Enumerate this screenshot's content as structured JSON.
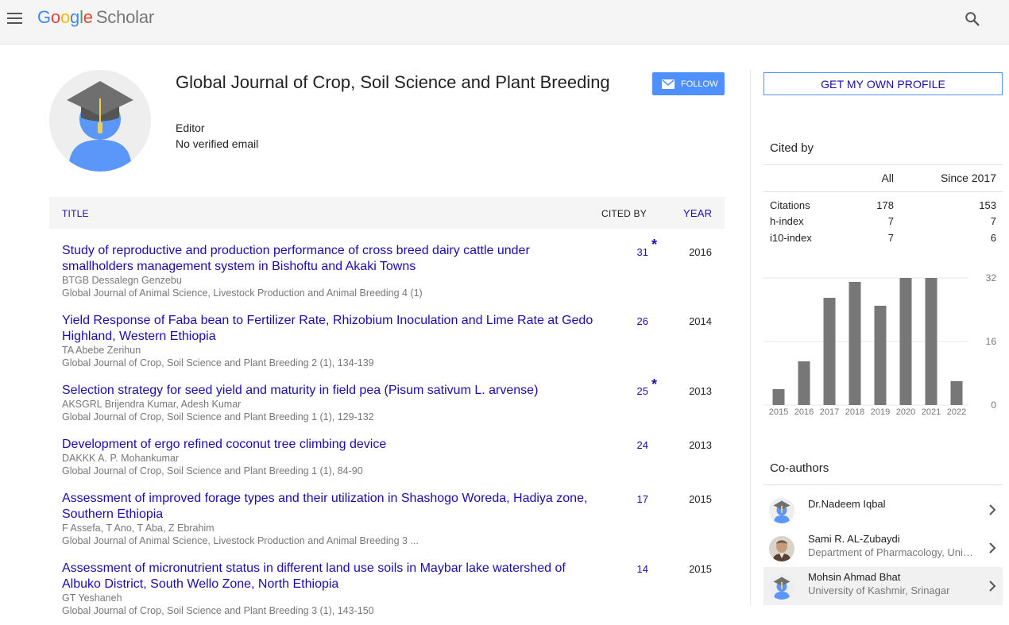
{
  "header": {
    "logo_g": "G",
    "logo_o1": "o",
    "logo_o2": "o",
    "logo_g2": "g",
    "logo_l": "l",
    "logo_e": "e",
    "logo_scholar": "Scholar",
    "menu_icon": "hamburger-icon",
    "search_icon": "search-icon"
  },
  "profile": {
    "name": "Global Journal of Crop, Soil Science and Plant Breeding",
    "affiliation": "Editor",
    "email": "No verified email",
    "follow_label": "FOLLOW"
  },
  "table": {
    "col_title": "TITLE",
    "col_cited": "CITED BY",
    "col_year": "YEAR",
    "rows": [
      {
        "title": "Study of reproductive and production performance of cross breed dairy cattle under smallholders management system in Bishoftu and Akaki Towns",
        "authors": "BTGB Dessalegn Genzebu",
        "venue": "Global Journal of Animal Science, Livestock Production and Animal Breeding 4 (1)",
        "cites": "31",
        "star": "*",
        "year": "2016"
      },
      {
        "title": "Yield Response of Faba bean to Fertilizer Rate, Rhizobium Inoculation and Lime Rate at Gedo Highland, Western Ethiopia",
        "authors": "TA Abebe Zerihun",
        "venue": "Global Journal of Crop, Soil Science and Plant Breeding 2 (1), 134-139",
        "cites": "26",
        "star": "",
        "year": "2014"
      },
      {
        "title": "Selection strategy for seed yield and maturity in field pea (Pisum sativum L. arvense)",
        "authors": "AKSGRL Brijendra Kumar, Adesh Kumar",
        "venue": "Global Journal of Crop, Soil Science and Plant Breeding 1 (1), 129-132",
        "cites": "25",
        "star": "*",
        "year": "2013"
      },
      {
        "title": "Development of ergo refined coconut tree climbing device",
        "authors": "DAKKK A. P. Mohankumar",
        "venue": "Global Journal of Crop, Soil Science and Plant Breeding 1 (1), 84-90",
        "cites": "24",
        "star": "",
        "year": "2013"
      },
      {
        "title": "Assessment of improved forage types and their utilization in Shashogo Woreda, Hadiya zone, Southern Ethiopia",
        "authors": "F Assefa, T Ano, T Aba, Z Ebrahim",
        "venue": "Global Journal of Animal Science, Livestock Production and Animal Breeding 3 ...",
        "cites": "17",
        "star": "",
        "year": "2015"
      },
      {
        "title": "Assessment of micronutrient status in different land use soils in Maybar lake watershed of Albuko District, South Wello Zone, North Ethiopia",
        "authors": "GT Yeshaneh",
        "venue": "Global Journal of Crop, Soil Science and Plant Breeding 3 (1), 143-150",
        "cites": "14",
        "star": "",
        "year": "2015"
      }
    ]
  },
  "sidebar": {
    "get_profile_label": "GET MY OWN PROFILE",
    "cited_by_heading": "Cited by",
    "col_all": "All",
    "col_since": "Since 2017",
    "metrics": [
      {
        "label": "Citations",
        "all": "178",
        "since": "153"
      },
      {
        "label": "h-index",
        "all": "7",
        "since": "7"
      },
      {
        "label": "i10-index",
        "all": "7",
        "since": "6"
      }
    ],
    "coauthors_heading": "Co-authors",
    "coauthors": [
      {
        "name": "Dr.Nadeem Iqbal",
        "affiliation": "",
        "avatar": "default-avatar-icon"
      },
      {
        "name": "Sami R. AL-Zubaydi",
        "affiliation": "Department of Pharmacology, University of Baghdad",
        "avatar": "person-photo"
      },
      {
        "name": "Mohsin Ahmad Bhat",
        "affiliation": "University of Kashmir, Srinagar",
        "avatar": "default-avatar-icon"
      }
    ]
  },
  "chart_data": {
    "type": "bar",
    "categories": [
      "2015",
      "2016",
      "2017",
      "2018",
      "2019",
      "2020",
      "2021",
      "2022"
    ],
    "values": [
      4,
      11,
      27,
      31,
      25,
      32,
      32,
      6
    ],
    "title": "",
    "xlabel": "",
    "ylabel": "",
    "ylim": [
      0,
      32
    ],
    "yticks": [
      "32",
      "16",
      "0"
    ],
    "ytick_values": [
      32,
      16,
      0
    ],
    "grid": true,
    "bar_color": "#777777"
  },
  "colors": {
    "link": "#1a0dab",
    "accent": "#4d90fe",
    "muted": "#777777",
    "header_bg": "#f5f5f5"
  }
}
